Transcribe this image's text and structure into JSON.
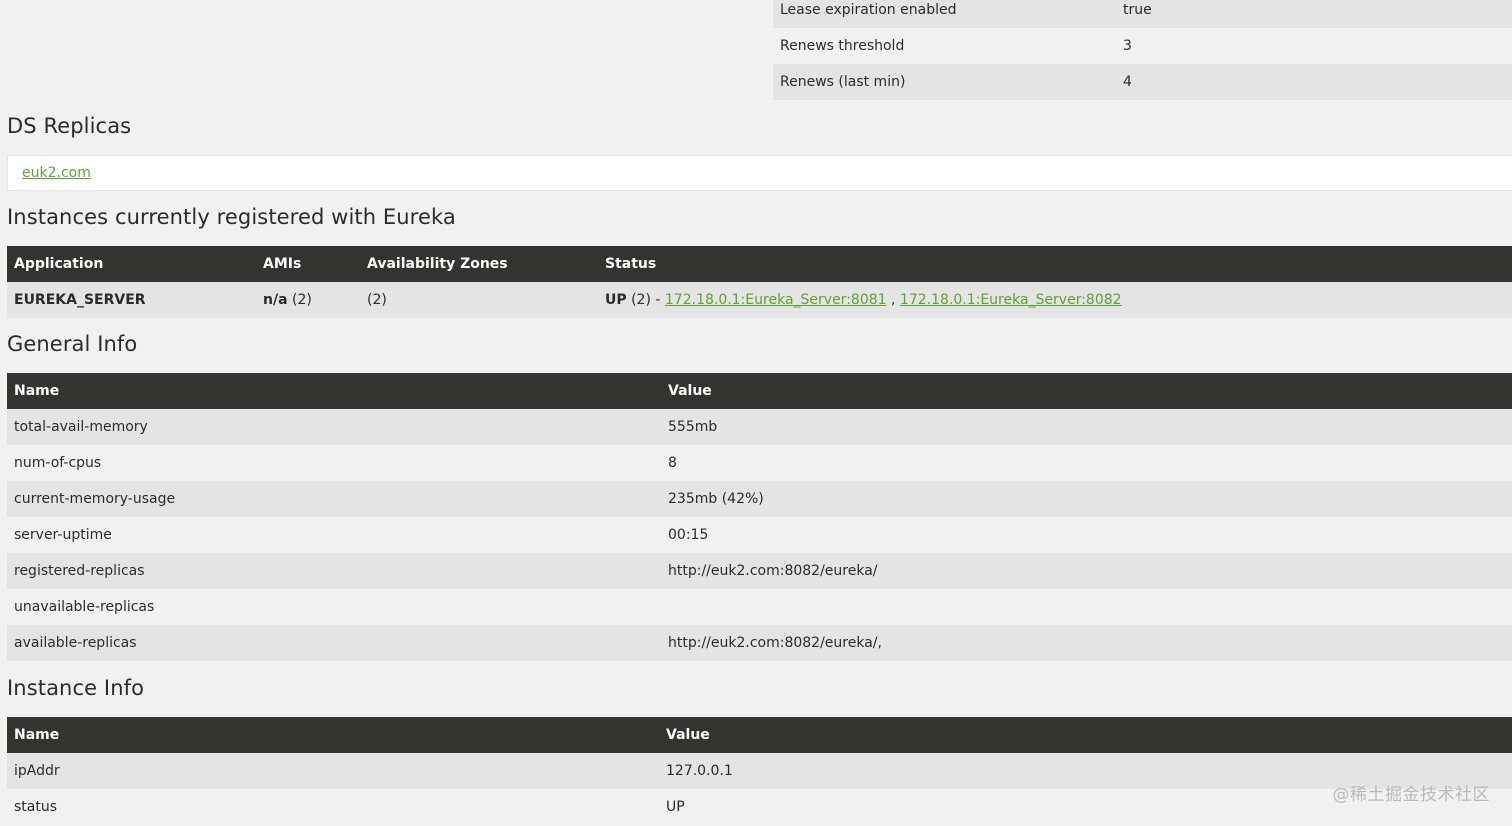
{
  "lease_table": {
    "rows": [
      {
        "name": "Lease expiration enabled",
        "value": "true"
      },
      {
        "name": "Renews threshold",
        "value": "3"
      },
      {
        "name": "Renews (last min)",
        "value": "4"
      }
    ]
  },
  "ds_replicas": {
    "title": "DS Replicas",
    "link": "euk2.com"
  },
  "instances": {
    "title": "Instances currently registered with Eureka",
    "headers": [
      "Application",
      "AMIs",
      "Availability Zones",
      "Status"
    ],
    "rows": [
      {
        "application": "EUREKA_SERVER",
        "amis_bold": "n/a",
        "amis_count": "(2)",
        "zones": "(2)",
        "status_bold": "UP",
        "status_count": "(2) -",
        "link1": "172.18.0.1:Eureka_Server:8081",
        "separator": ",",
        "link2": "172.18.0.1:Eureka_Server:8082"
      }
    ]
  },
  "general_info": {
    "title": "General Info",
    "headers": [
      "Name",
      "Value"
    ],
    "rows": [
      {
        "name": "total-avail-memory",
        "value": "555mb"
      },
      {
        "name": "num-of-cpus",
        "value": "8"
      },
      {
        "name": "current-memory-usage",
        "value": "235mb (42%)"
      },
      {
        "name": "server-uptime",
        "value": "00:15"
      },
      {
        "name": "registered-replicas",
        "value": "http://euk2.com:8082/eureka/"
      },
      {
        "name": "unavailable-replicas",
        "value": ""
      },
      {
        "name": "available-replicas",
        "value": "http://euk2.com:8082/eureka/,"
      }
    ]
  },
  "instance_info": {
    "title": "Instance Info",
    "headers": [
      "Name",
      "Value"
    ],
    "rows": [
      {
        "name": "ipAddr",
        "value": "127.0.0.1"
      },
      {
        "name": "status",
        "value": "UP"
      }
    ]
  },
  "watermark": "@稀土掘金技术社区",
  "colors": {
    "header_bg": "#353330",
    "link": "#5fa134",
    "row_stripe": "#e4e4e4",
    "page_bg": "#f1f1f1"
  }
}
